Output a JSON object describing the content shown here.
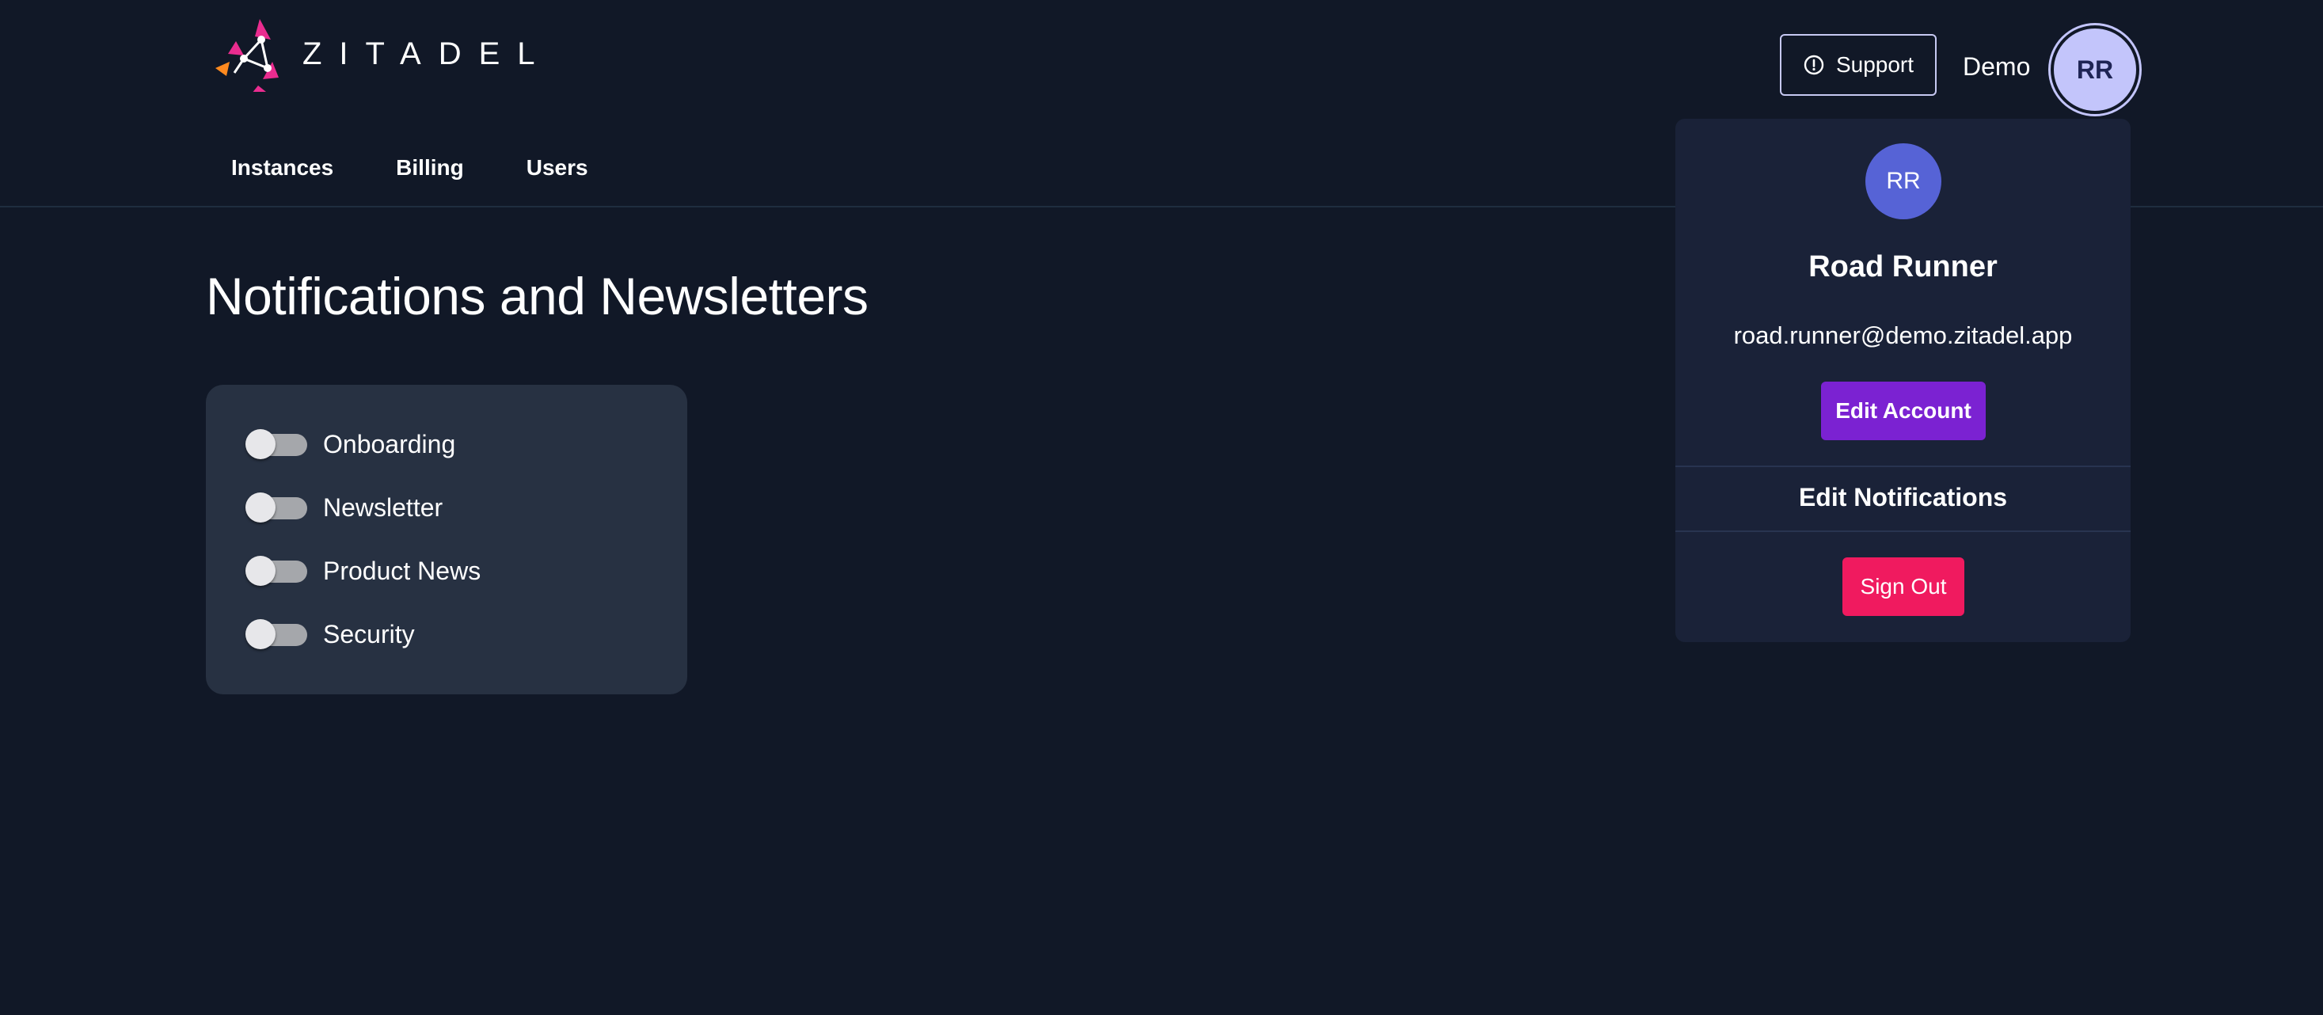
{
  "header": {
    "logo_text": "ZITADEL",
    "support_label": "Support",
    "org_name": "Demo",
    "avatar_initials": "RR"
  },
  "nav": {
    "items": [
      {
        "label": "Instances"
      },
      {
        "label": "Billing"
      },
      {
        "label": "Users"
      }
    ]
  },
  "main": {
    "title": "Notifications and Newsletters",
    "toggles": [
      {
        "label": "Onboarding",
        "checked": false
      },
      {
        "label": "Newsletter",
        "checked": false
      },
      {
        "label": "Product News",
        "checked": false
      },
      {
        "label": "Security",
        "checked": false
      }
    ]
  },
  "account_menu": {
    "avatar_initials": "RR",
    "name": "Road Runner",
    "email": "road.runner@demo.zitadel.app",
    "edit_account_label": "Edit Account",
    "edit_notifications_label": "Edit Notifications",
    "sign_out_label": "Sign Out"
  },
  "icons": {
    "logo": "zitadel-logo-icon",
    "support": "alert-circle-icon"
  },
  "colors": {
    "background": "#111827",
    "card": "#273142",
    "menu": "#1a2238",
    "edit_account": "#7b22d2",
    "sign_out": "#f01a5f",
    "avatar_top": "#c3c5fb",
    "avatar_menu": "#5663d6"
  }
}
